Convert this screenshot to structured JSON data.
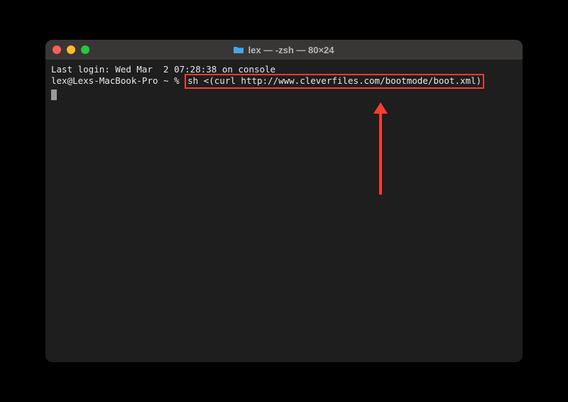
{
  "window": {
    "title": "lex — -zsh — 80×24"
  },
  "terminal": {
    "last_login": "Last login: Wed Mar  2 07:28:38 on console",
    "prompt": "lex@Lexs-MacBook-Pro ~ % ",
    "command": "sh <(curl http://www.cleverfiles.com/bootmode/boot.xml)"
  },
  "annotations": {
    "highlight_color": "#ff3b30"
  }
}
